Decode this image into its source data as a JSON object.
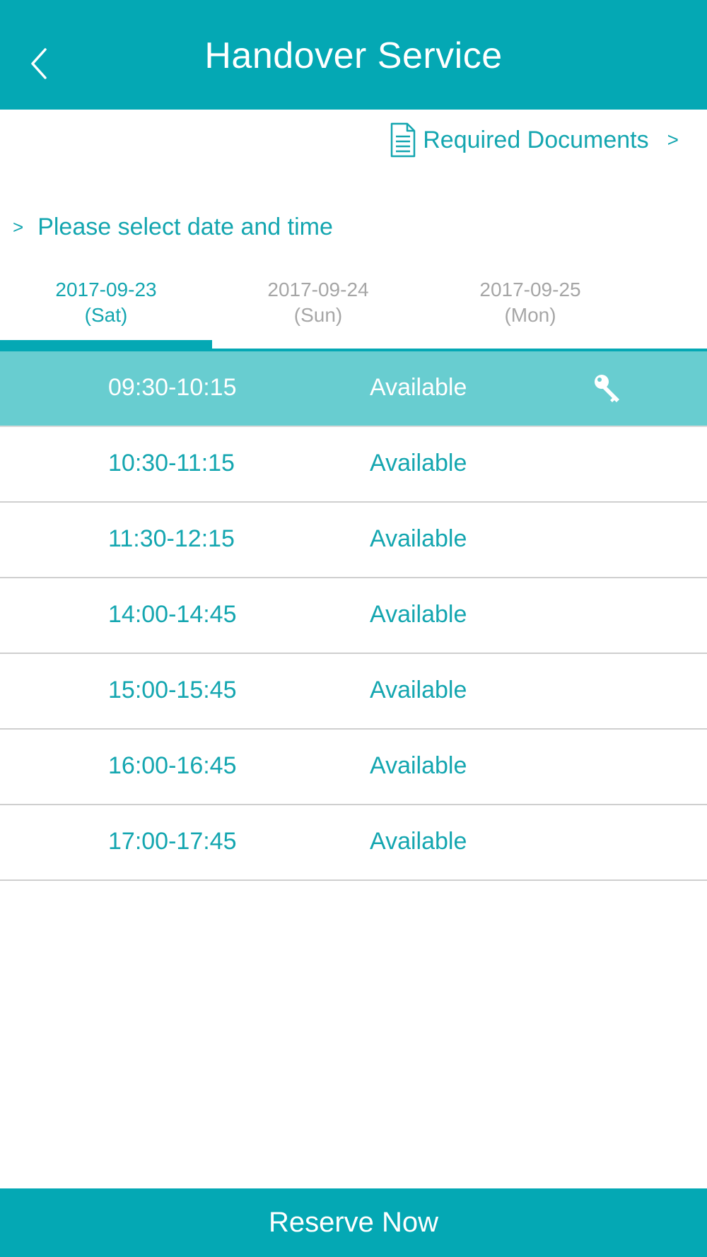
{
  "colors": {
    "brand": "#04a8b4",
    "selected_row": "#68cdd0",
    "accent_text": "#14a6b0",
    "inactive_tab": "#a6a6a6"
  },
  "header": {
    "title": "Handover Service",
    "back_icon": "chevron-left-icon"
  },
  "docs_link": {
    "icon": "document-icon",
    "label": "Required Documents",
    "chevron": ">"
  },
  "section": {
    "chevron": ">",
    "heading": "Please select date and time"
  },
  "tabs": [
    {
      "date": "2017-09-23",
      "day": "(Sat)",
      "active": true
    },
    {
      "date": "2017-09-24",
      "day": "(Sun)",
      "active": false
    },
    {
      "date": "2017-09-25",
      "day": "(Mon)",
      "active": false
    }
  ],
  "slots": [
    {
      "time": "09:30-10:15",
      "status": "Available",
      "selected": true,
      "icon": "key-icon"
    },
    {
      "time": "10:30-11:15",
      "status": "Available",
      "selected": false
    },
    {
      "time": "11:30-12:15",
      "status": "Available",
      "selected": false
    },
    {
      "time": "14:00-14:45",
      "status": "Available",
      "selected": false
    },
    {
      "time": "15:00-15:45",
      "status": "Available",
      "selected": false
    },
    {
      "time": "16:00-16:45",
      "status": "Available",
      "selected": false
    },
    {
      "time": "17:00-17:45",
      "status": "Available",
      "selected": false
    }
  ],
  "footer": {
    "reserve_label": "Reserve Now"
  }
}
